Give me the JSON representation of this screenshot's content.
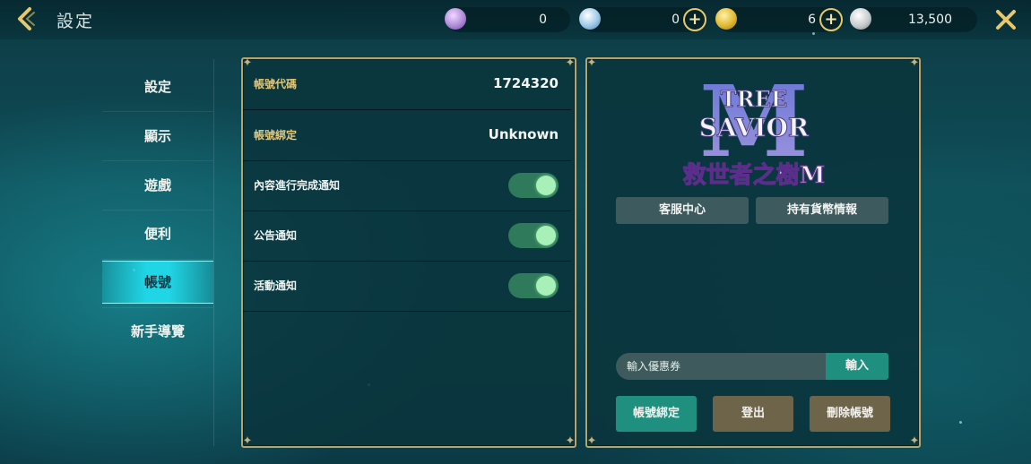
{
  "header": {
    "title": "設定",
    "currencies": [
      {
        "name": "purple-gem",
        "value": "0",
        "color": "#b08ad8",
        "has_plus": false
      },
      {
        "name": "blue-crystal",
        "value": "0",
        "color": "#9cc8e8",
        "has_plus": true
      },
      {
        "name": "gold-coin",
        "value": "6",
        "color": "#e0b830",
        "has_plus": true
      },
      {
        "name": "silver-coin",
        "value": "13,500",
        "color": "#c8cccc",
        "has_plus": false
      }
    ]
  },
  "sidebar": {
    "items": [
      {
        "label": "設定",
        "active": false
      },
      {
        "label": "顯示",
        "active": false
      },
      {
        "label": "遊戲",
        "active": false
      },
      {
        "label": "便利",
        "active": false
      },
      {
        "label": "帳號",
        "active": true
      },
      {
        "label": "新手導覽",
        "active": false
      }
    ]
  },
  "account": {
    "rows": [
      {
        "label": "帳號代碼",
        "value": "1724320"
      },
      {
        "label": "帳號綁定",
        "value": "Unknown"
      }
    ],
    "toggles": [
      {
        "label": "內容進行完成通知",
        "on": true
      },
      {
        "label": "公告通知",
        "on": true
      },
      {
        "label": "活動通知",
        "on": true
      }
    ]
  },
  "right_panel": {
    "logo_title_1": "TREE",
    "logo_title_2": "SAVIOR",
    "logo_letter": "M",
    "logo_subtitle": "救世者之樹M",
    "support_label": "客服中心",
    "currency_info_label": "持有貨幣情報",
    "coupon_placeholder": "輸入優惠券",
    "coupon_submit_label": "輸入",
    "bind_label": "帳號綁定",
    "logout_label": "登出",
    "delete_label": "刪除帳號"
  },
  "colors": {
    "accent_gold": "#e8c86a",
    "active_tab": "#20d6e6",
    "toggle_on": "#2e7a5a"
  }
}
